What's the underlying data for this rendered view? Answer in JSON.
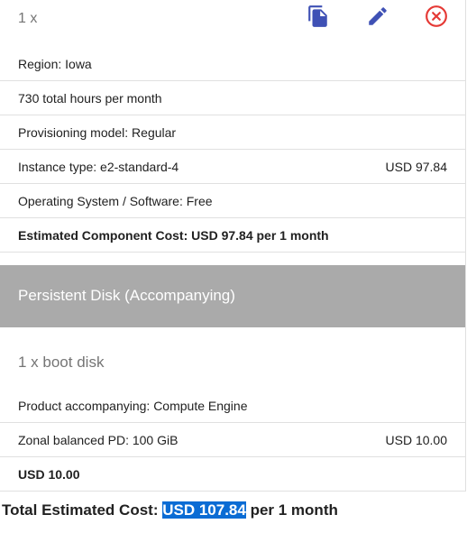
{
  "compute": {
    "quantity": "1 x",
    "actions": {
      "copy_icon": "copy-icon",
      "edit_icon": "edit-icon",
      "delete_icon": "delete-icon",
      "accent_color": "#3f51b5",
      "delete_color": "#e53935"
    },
    "rows": [
      {
        "label": "Region: Iowa",
        "price": ""
      },
      {
        "label": "730 total hours per month",
        "price": ""
      },
      {
        "label": "Provisioning model: Regular",
        "price": ""
      },
      {
        "label": "Instance type: e2-standard-4",
        "price": "USD 97.84"
      },
      {
        "label": "Operating System / Software: Free",
        "price": ""
      }
    ],
    "estimated_cost": "Estimated Component Cost: USD 97.84 per 1 month"
  },
  "disk": {
    "section_title": "Persistent Disk (Accompanying)",
    "quantity_title": "1 x boot disk",
    "rows": [
      {
        "label": "Product accompanying: Compute Engine",
        "price": ""
      },
      {
        "label": "Zonal balanced PD: 100 GiB",
        "price": "USD 10.00"
      }
    ],
    "cost": "USD 10.00"
  },
  "total": {
    "label": "Total Estimated Cost:",
    "amount": "USD 107.84",
    "suffix": "per 1 month",
    "highlight_color": "#0b6cd4"
  }
}
